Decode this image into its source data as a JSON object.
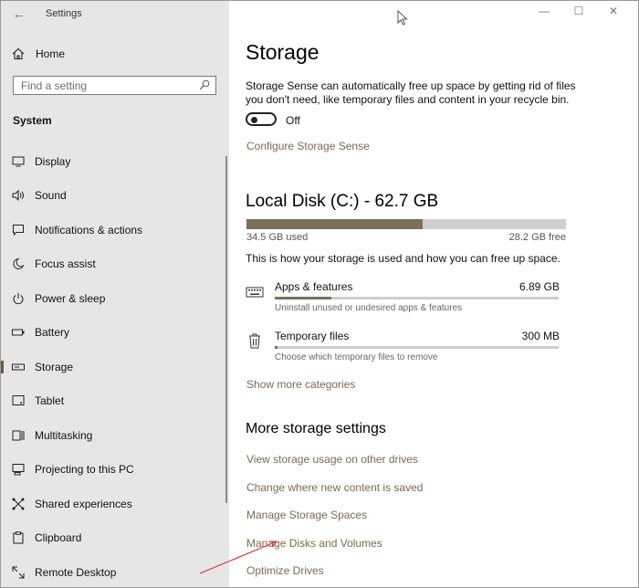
{
  "window": {
    "title": "Settings"
  },
  "sidebar": {
    "home_label": "Home",
    "search_placeholder": "Find a setting",
    "section_title": "System",
    "items": [
      {
        "label": "Display",
        "icon": "monitor-icon"
      },
      {
        "label": "Sound",
        "icon": "speaker-icon"
      },
      {
        "label": "Notifications & actions",
        "icon": "notification-icon"
      },
      {
        "label": "Focus assist",
        "icon": "moon-icon"
      },
      {
        "label": "Power & sleep",
        "icon": "power-icon"
      },
      {
        "label": "Battery",
        "icon": "battery-icon"
      },
      {
        "label": "Storage",
        "icon": "storage-icon",
        "active": true
      },
      {
        "label": "Tablet",
        "icon": "tablet-icon"
      },
      {
        "label": "Multitasking",
        "icon": "multitasking-icon"
      },
      {
        "label": "Projecting to this PC",
        "icon": "projecting-icon"
      },
      {
        "label": "Shared experiences",
        "icon": "shared-experiences-icon"
      },
      {
        "label": "Clipboard",
        "icon": "clipboard-icon"
      },
      {
        "label": "Remote Desktop",
        "icon": "remote-desktop-icon"
      }
    ]
  },
  "main": {
    "title": "Storage",
    "sense_description_line1": "Storage Sense can automatically free up space by getting rid of files",
    "sense_description_line2": "you don't need, like temporary files and content in your recycle bin.",
    "toggle_state": "Off",
    "configure_link": "Configure Storage Sense",
    "disk_title": "Local Disk (C:) - 62.7 GB",
    "disk_used_fraction": 0.55,
    "used_label": "34.5 GB used",
    "free_label": "28.2 GB free",
    "usage_description": "This is how your storage is used and how you can free up space.",
    "categories": [
      {
        "name": "Apps & features",
        "size": "6.89 GB",
        "desc": "Uninstall unused or undesired apps & features",
        "fraction": 0.2
      },
      {
        "name": "Temporary files",
        "size": "300 MB",
        "desc": "Choose which temporary files to remove",
        "fraction": 0.01
      }
    ],
    "show_more_link": "Show more categories",
    "more_settings_title": "More storage settings",
    "more_links": [
      "View storage usage on other drives",
      "Change where new content is saved",
      "Manage Storage Spaces",
      "Manage Disks and Volumes",
      "Optimize Drives"
    ]
  },
  "colors": {
    "accent": "#7b6a4f",
    "sidebar_bg": "#e6e6e6",
    "bar_fill": "#7b6e5b",
    "annotation_arrow": "#d83a3a"
  }
}
